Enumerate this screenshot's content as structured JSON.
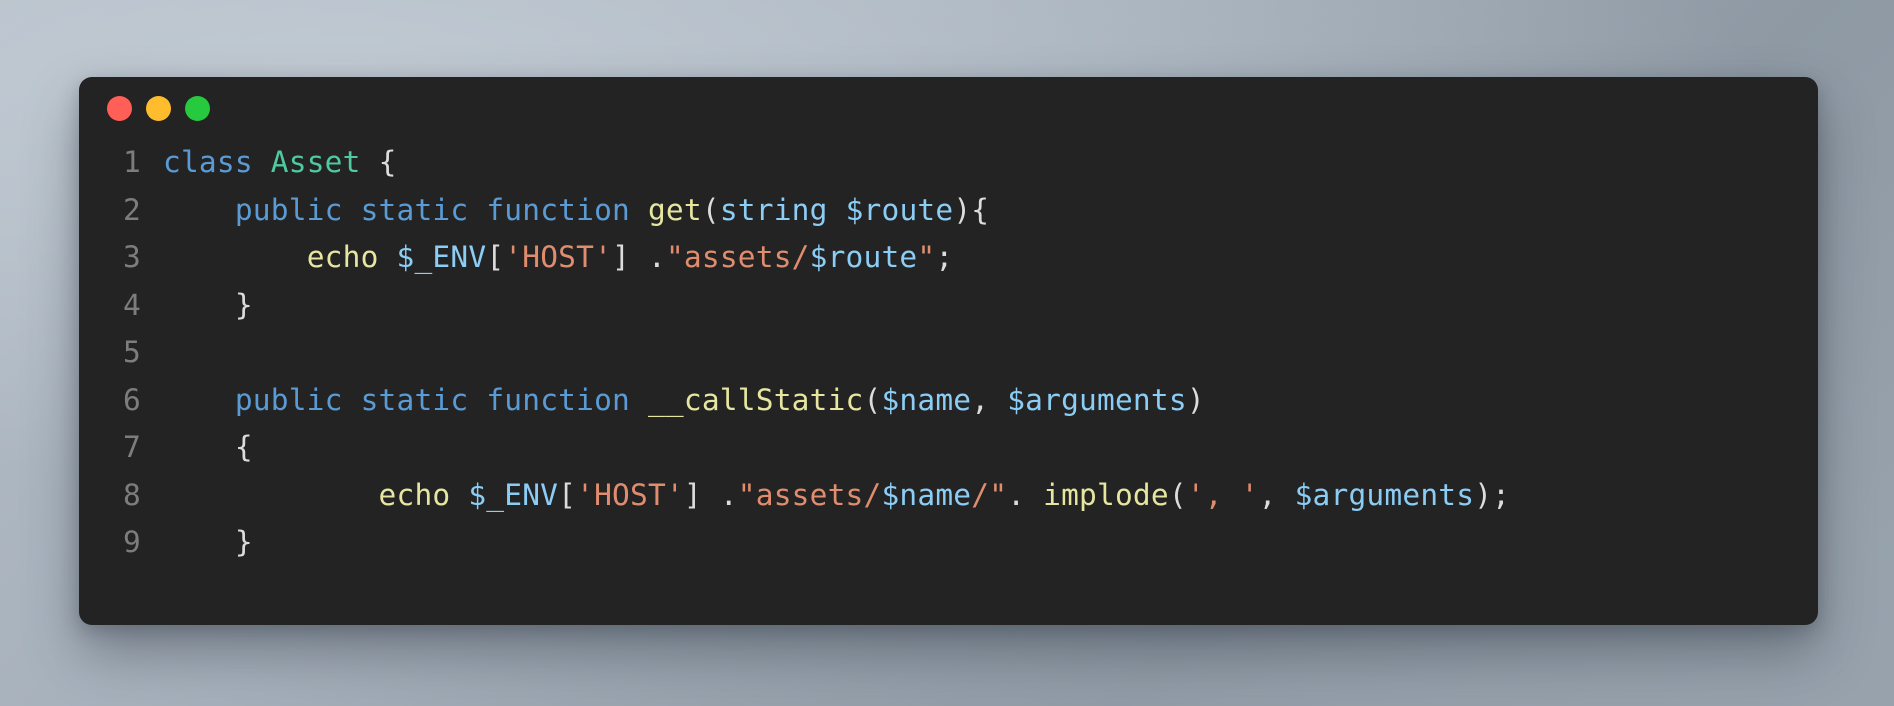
{
  "window": {
    "background_color": "#232323",
    "traffic_lights": [
      {
        "name": "close",
        "color": "#ff5f56"
      },
      {
        "name": "minimize",
        "color": "#ffbd2e"
      },
      {
        "name": "maximize",
        "color": "#27c93f"
      }
    ]
  },
  "page": {
    "background_gradient_from": "#b3bcc6",
    "background_gradient_to": "#8e99a4"
  },
  "editor": {
    "language": "php",
    "gutter_color": "#7d7d7d",
    "line_numbers": [
      "1",
      "2",
      "3",
      "4",
      "5",
      "6",
      "7",
      "8",
      "9"
    ],
    "lines": [
      {
        "number": "1",
        "text": "class Asset {",
        "tokens": [
          {
            "t": "class",
            "c": "kw"
          },
          {
            "t": " ",
            "c": "plain"
          },
          {
            "t": "Asset",
            "c": "class"
          },
          {
            "t": " ",
            "c": "plain"
          },
          {
            "t": "{",
            "c": "punct"
          }
        ]
      },
      {
        "number": "2",
        "text": "    public static function get(string $route){",
        "tokens": [
          {
            "t": "    ",
            "c": "plain"
          },
          {
            "t": "public",
            "c": "kw"
          },
          {
            "t": " ",
            "c": "plain"
          },
          {
            "t": "static",
            "c": "kw"
          },
          {
            "t": " ",
            "c": "plain"
          },
          {
            "t": "function",
            "c": "kw"
          },
          {
            "t": " ",
            "c": "plain"
          },
          {
            "t": "get",
            "c": "fn"
          },
          {
            "t": "(",
            "c": "punct"
          },
          {
            "t": "string",
            "c": "var"
          },
          {
            "t": " ",
            "c": "plain"
          },
          {
            "t": "$route",
            "c": "var"
          },
          {
            "t": ")",
            "c": "punct"
          },
          {
            "t": "{",
            "c": "punct"
          }
        ]
      },
      {
        "number": "3",
        "text": "        echo $_ENV['HOST'] .\"assets/$route\";",
        "tokens": [
          {
            "t": "        ",
            "c": "plain"
          },
          {
            "t": "echo",
            "c": "fn"
          },
          {
            "t": " ",
            "c": "plain"
          },
          {
            "t": "$_ENV",
            "c": "var"
          },
          {
            "t": "[",
            "c": "punct"
          },
          {
            "t": "'HOST'",
            "c": "str"
          },
          {
            "t": "]",
            "c": "punct"
          },
          {
            "t": " .",
            "c": "punct"
          },
          {
            "t": "\"assets/",
            "c": "str"
          },
          {
            "t": "$route",
            "c": "var"
          },
          {
            "t": "\"",
            "c": "str"
          },
          {
            "t": ";",
            "c": "punct"
          }
        ]
      },
      {
        "number": "4",
        "text": "    }",
        "tokens": [
          {
            "t": "    ",
            "c": "plain"
          },
          {
            "t": "}",
            "c": "punct"
          }
        ]
      },
      {
        "number": "5",
        "text": "",
        "tokens": []
      },
      {
        "number": "6",
        "text": "    public static function __callStatic($name, $arguments)",
        "tokens": [
          {
            "t": "    ",
            "c": "plain"
          },
          {
            "t": "public",
            "c": "kw"
          },
          {
            "t": " ",
            "c": "plain"
          },
          {
            "t": "static",
            "c": "kw"
          },
          {
            "t": " ",
            "c": "plain"
          },
          {
            "t": "function",
            "c": "kw"
          },
          {
            "t": " ",
            "c": "plain"
          },
          {
            "t": "__callStatic",
            "c": "fn"
          },
          {
            "t": "(",
            "c": "punct"
          },
          {
            "t": "$name",
            "c": "var"
          },
          {
            "t": ", ",
            "c": "punct"
          },
          {
            "t": "$arguments",
            "c": "var"
          },
          {
            "t": ")",
            "c": "punct"
          }
        ]
      },
      {
        "number": "7",
        "text": "    {",
        "tokens": [
          {
            "t": "    ",
            "c": "plain"
          },
          {
            "t": "{",
            "c": "punct"
          }
        ]
      },
      {
        "number": "8",
        "text": "            echo $_ENV['HOST'] .\"assets/$name/\". implode(', ', $arguments);",
        "tokens": [
          {
            "t": "            ",
            "c": "plain"
          },
          {
            "t": "echo",
            "c": "fn"
          },
          {
            "t": " ",
            "c": "plain"
          },
          {
            "t": "$_ENV",
            "c": "var"
          },
          {
            "t": "[",
            "c": "punct"
          },
          {
            "t": "'HOST'",
            "c": "str"
          },
          {
            "t": "]",
            "c": "punct"
          },
          {
            "t": " .",
            "c": "punct"
          },
          {
            "t": "\"assets/",
            "c": "str"
          },
          {
            "t": "$name",
            "c": "var"
          },
          {
            "t": "/\"",
            "c": "str"
          },
          {
            "t": ". ",
            "c": "punct"
          },
          {
            "t": "implode",
            "c": "fn"
          },
          {
            "t": "(",
            "c": "punct"
          },
          {
            "t": "', '",
            "c": "str"
          },
          {
            "t": ", ",
            "c": "punct"
          },
          {
            "t": "$arguments",
            "c": "var"
          },
          {
            "t": ")",
            "c": "punct"
          },
          {
            "t": ";",
            "c": "punct"
          }
        ]
      },
      {
        "number": "9",
        "text": "    }",
        "tokens": [
          {
            "t": "    ",
            "c": "plain"
          },
          {
            "t": "}",
            "c": "punct"
          }
        ]
      }
    ]
  }
}
